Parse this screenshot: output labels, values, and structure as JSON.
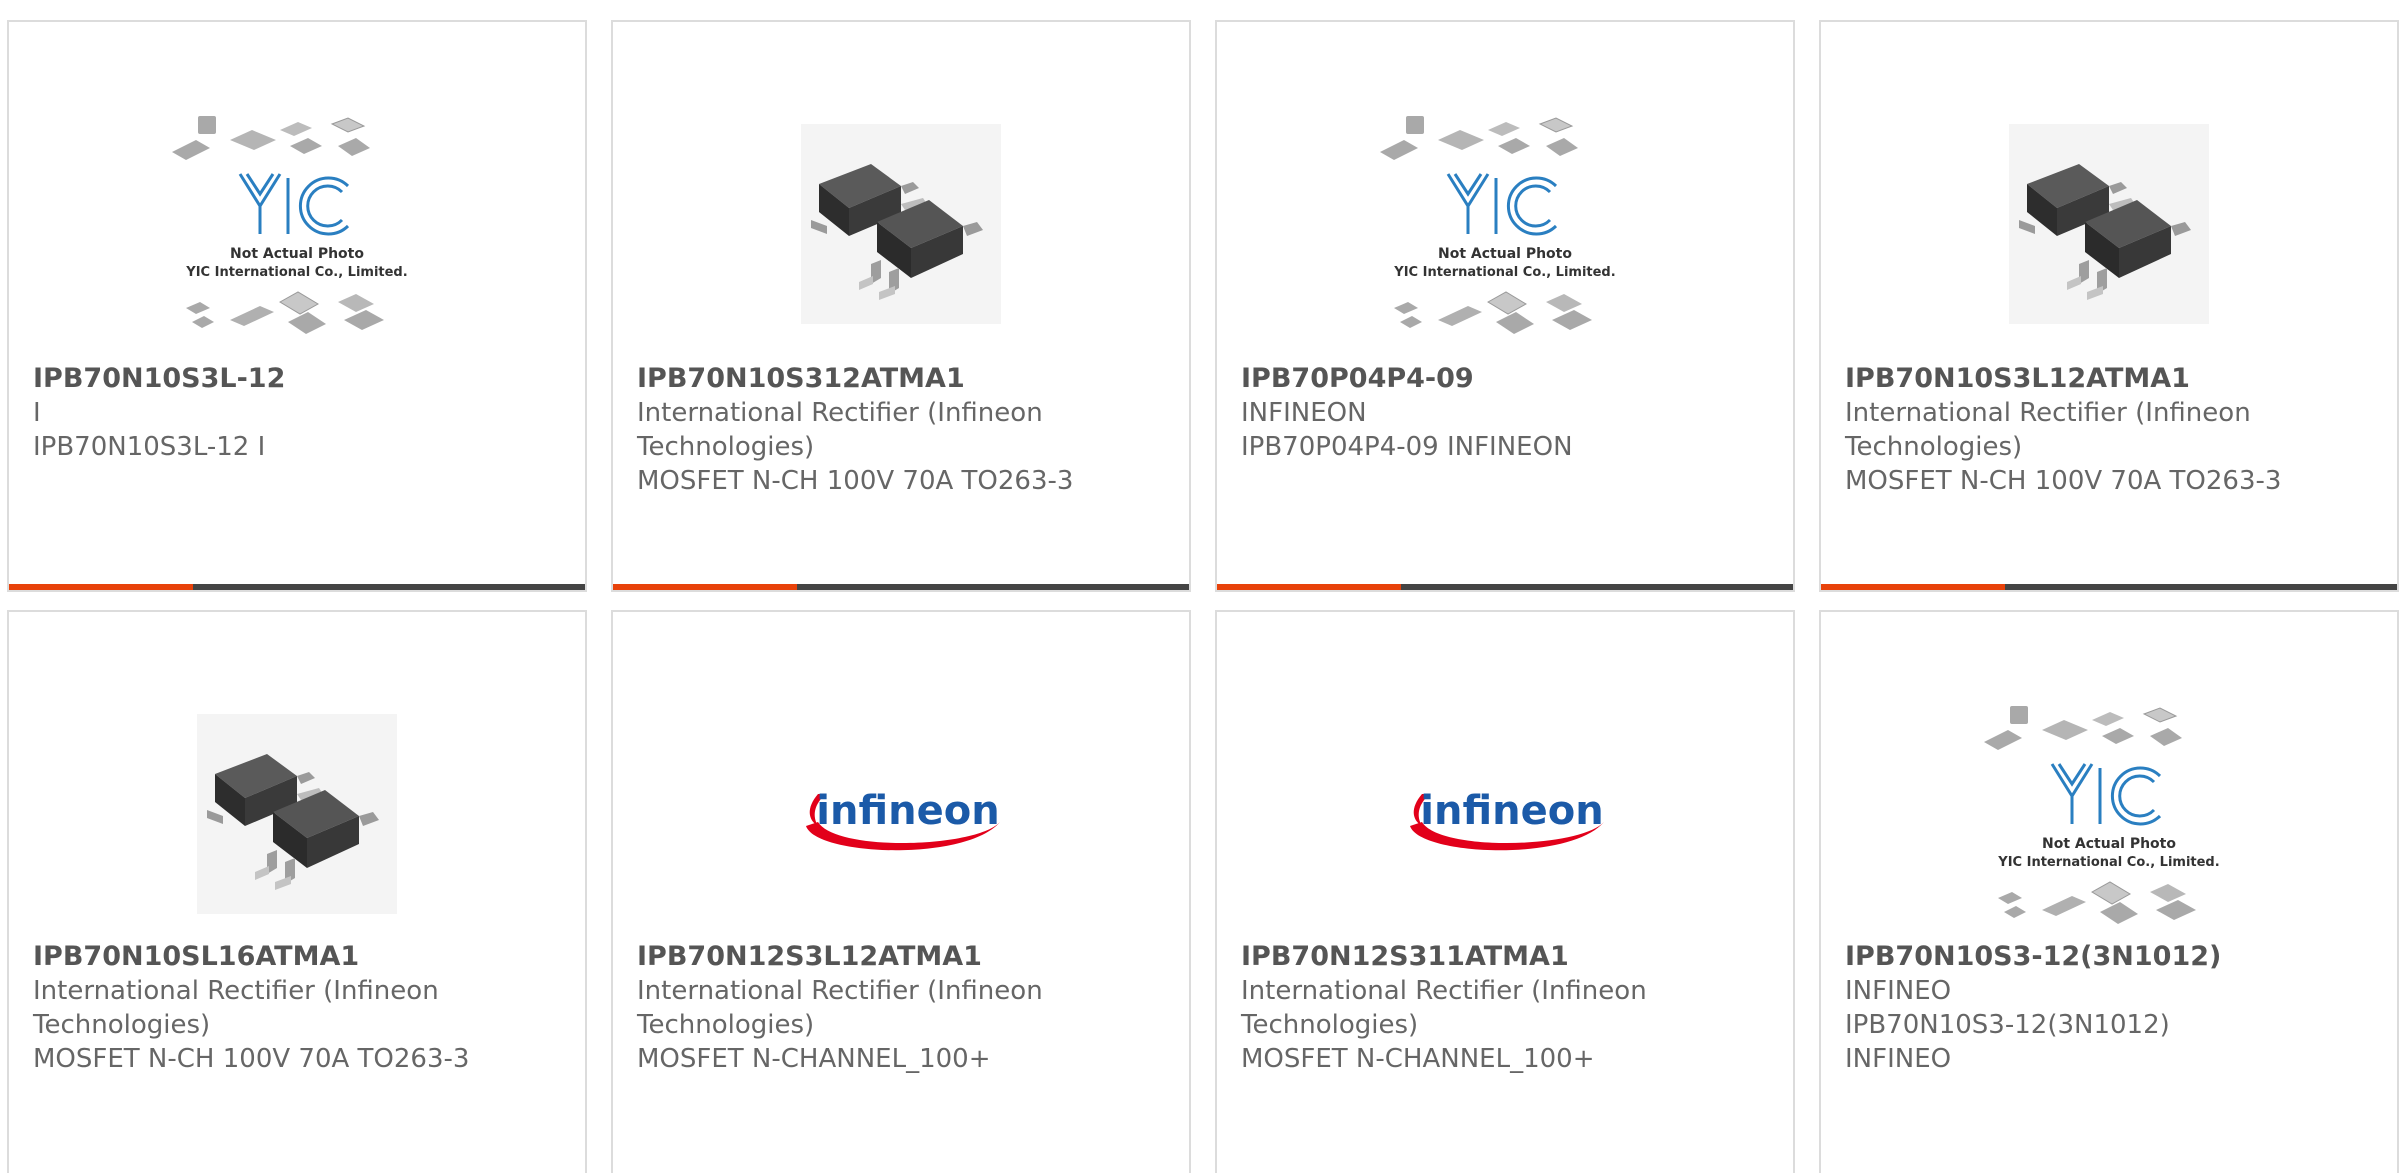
{
  "colors": {
    "accent": "#e8420a",
    "bar_dark": "#444444",
    "title_text": "#555555",
    "body_text": "#666666",
    "card_border": "#dcdcdc",
    "infineon_blue": "#1b5aa8",
    "infineon_red": "#e2001a",
    "yic_blue": "#2a7fc1"
  },
  "placeholder": {
    "line1": "Not Actual Photo",
    "line2": "YIC International Co., Limited.",
    "logo": "YIC"
  },
  "infineon_logo": "infineon",
  "products": [
    {
      "part": "IPB70N10S3L-12",
      "lines": [
        "I",
        "IPB70N10S3L-12 I"
      ],
      "image": "placeholder"
    },
    {
      "part": "IPB70N10S312ATMA1",
      "lines": [
        "International Rectifier (Infineon",
        "Technologies)",
        "MOSFET N-CH 100V 70A TO263-3"
      ],
      "image": "chip"
    },
    {
      "part": "IPB70P04P4-09",
      "lines": [
        "INFINEON",
        "IPB70P04P4-09 INFINEON"
      ],
      "image": "placeholder"
    },
    {
      "part": "IPB70N10S3L12ATMA1",
      "lines": [
        "International Rectifier (Infineon",
        "Technologies)",
        "MOSFET N-CH 100V 70A TO263-3"
      ],
      "image": "chip"
    },
    {
      "part": "IPB70N10SL16ATMA1",
      "lines": [
        "International Rectifier (Infineon",
        "Technologies)",
        "MOSFET N-CH 100V 70A TO263-3"
      ],
      "image": "chip"
    },
    {
      "part": "IPB70N12S3L12ATMA1",
      "lines": [
        "International Rectifier (Infineon",
        "Technologies)",
        "MOSFET N-CHANNEL_100+"
      ],
      "image": "infineon"
    },
    {
      "part": "IPB70N12S311ATMA1",
      "lines": [
        "International Rectifier (Infineon",
        "Technologies)",
        "MOSFET N-CHANNEL_100+"
      ],
      "image": "infineon"
    },
    {
      "part": "IPB70N10S3-12(3N1012)",
      "lines": [
        "INFINEO",
        "IPB70N10S3-12(3N1012)",
        "INFINEO"
      ],
      "image": "placeholder"
    }
  ]
}
